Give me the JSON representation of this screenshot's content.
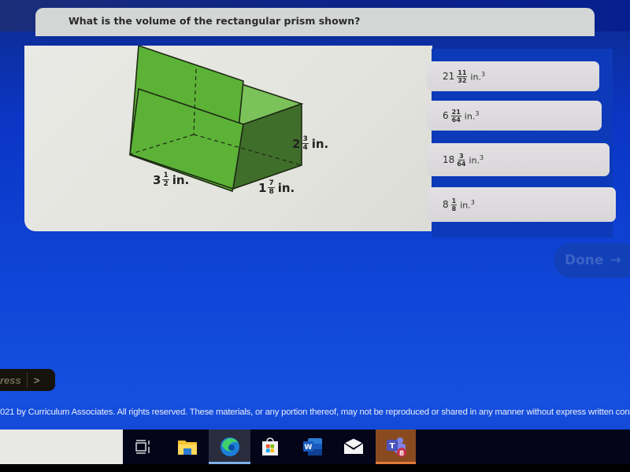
{
  "question": {
    "text": "What is the volume of the rectangular prism shown?"
  },
  "figure": {
    "shape": "rectangular prism",
    "fill_color": "#5fb53a",
    "labels": {
      "length": {
        "whole": "3",
        "num": "1",
        "den": "2",
        "unit": "in."
      },
      "width": {
        "whole": "1",
        "num": "7",
        "den": "8",
        "unit": "in."
      },
      "height": {
        "whole": "2",
        "num": "3",
        "den": "4",
        "unit": "in."
      }
    }
  },
  "choices": [
    {
      "whole": "21",
      "num": "11",
      "den": "32",
      "unit": "in.",
      "exp": "3"
    },
    {
      "whole": "6",
      "num": "21",
      "den": "64",
      "unit": "in.",
      "exp": "3"
    },
    {
      "whole": "18",
      "num": "3",
      "den": "64",
      "unit": "in.",
      "exp": "3"
    },
    {
      "whole": "8",
      "num": "1",
      "den": "8",
      "unit": "in.",
      "exp": "3"
    }
  ],
  "done_button": {
    "label": "Done",
    "icon": "arrow-right-icon"
  },
  "progress_button": {
    "label": "ress",
    "arrow": ">"
  },
  "copyright": "021 by Curriculum Associates. All rights reserved. These materials, or any portion thereof, may not be reproduced or shared in any manner without express written consent of C",
  "taskbar": {
    "items": [
      {
        "name": "task-view",
        "icon": "task-view-icon"
      },
      {
        "name": "file-explorer",
        "icon": "folder-icon"
      },
      {
        "name": "edge",
        "icon": "edge-icon",
        "active": true
      },
      {
        "name": "store",
        "icon": "store-icon"
      },
      {
        "name": "word",
        "icon": "word-icon",
        "letter": "W"
      },
      {
        "name": "mail",
        "icon": "mail-icon"
      },
      {
        "name": "teams",
        "icon": "teams-icon",
        "letter": "T",
        "badge": "8"
      }
    ]
  }
}
